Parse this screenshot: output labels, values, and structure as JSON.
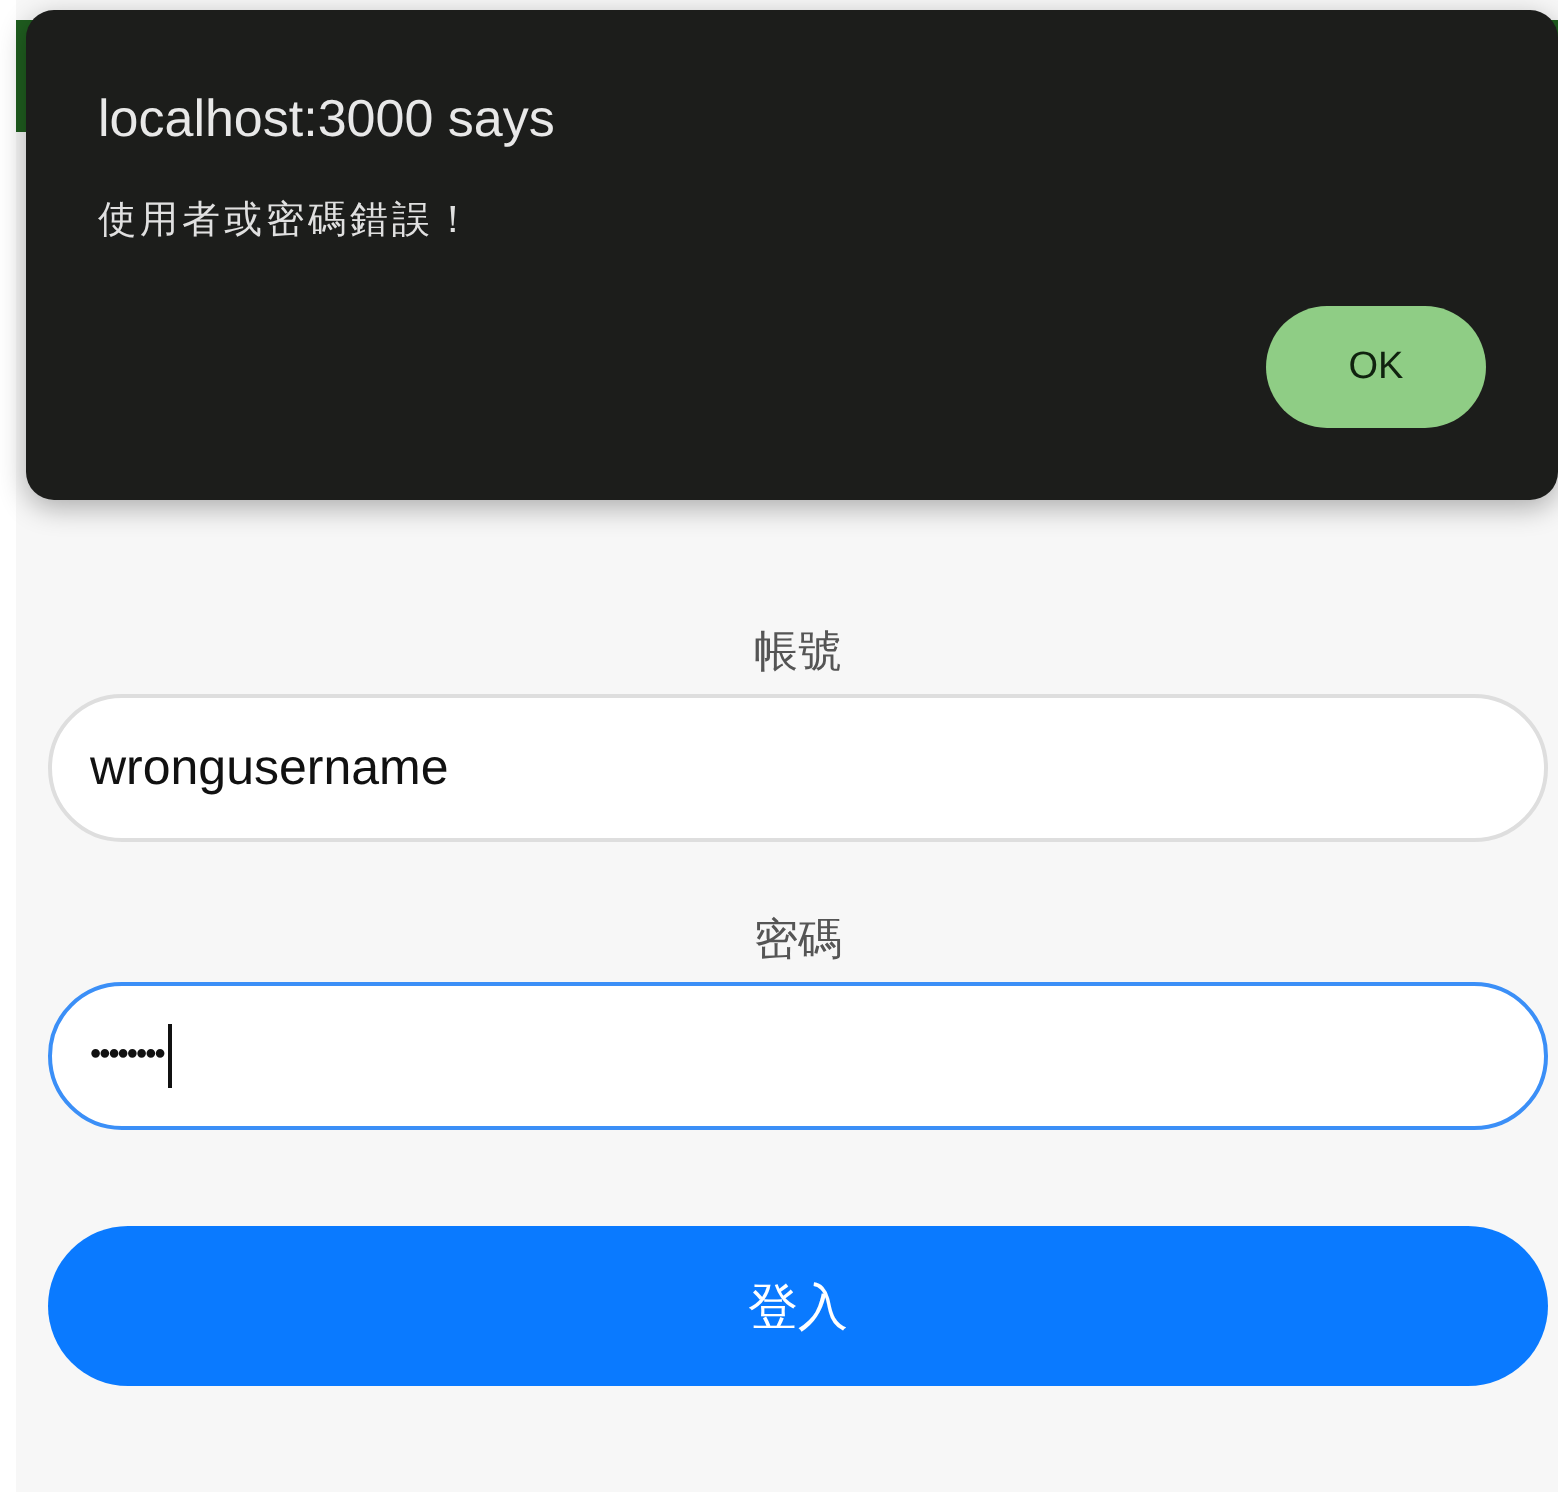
{
  "dialog": {
    "title": "localhost:3000 says",
    "message": "使用者或密碼錯誤！",
    "button": "OK"
  },
  "login": {
    "fields": [
      {
        "label": "帳號",
        "value": "wrongusername",
        "focused": false,
        "kind": "text"
      },
      {
        "label": "密碼",
        "value": "••••••••",
        "focused": true,
        "kind": "password"
      }
    ],
    "submit": "登入"
  }
}
